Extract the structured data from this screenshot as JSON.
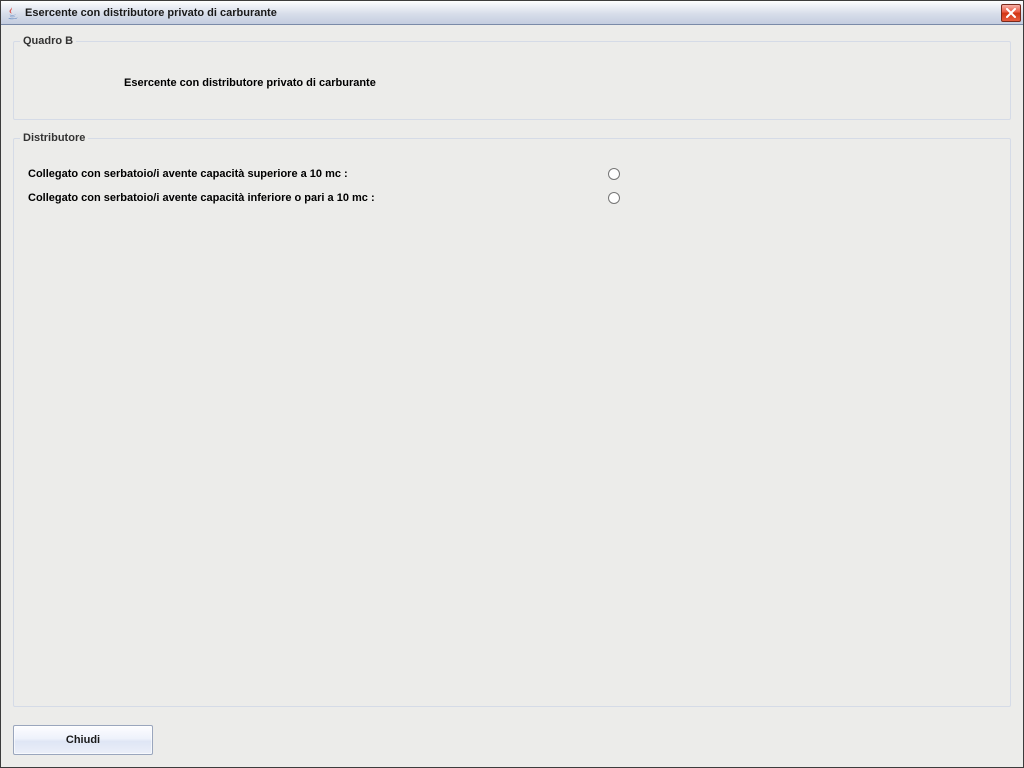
{
  "window": {
    "title": "Esercente con distributore privato di carburante"
  },
  "quadroB": {
    "legend": "Quadro B",
    "heading": "Esercente con distributore privato di carburante"
  },
  "distributore": {
    "legend": "Distributore",
    "options": [
      {
        "label": "Collegato con serbatoio/i avente capacità superiore a 10 mc :",
        "selected": false
      },
      {
        "label": "Collegato con serbatoio/i avente capacità inferiore o pari a 10 mc :",
        "selected": false
      }
    ]
  },
  "buttons": {
    "close": "Chiudi"
  }
}
